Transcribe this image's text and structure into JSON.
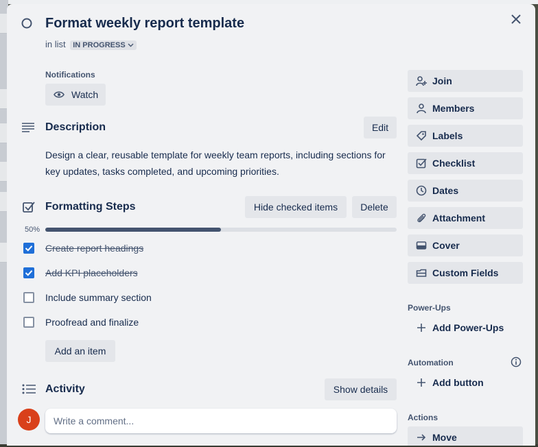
{
  "card": {
    "title": "Format weekly report template",
    "in_list_prefix": "in list",
    "list_name": "IN PROGRESS"
  },
  "notifications": {
    "label": "Notifications",
    "watch_label": "Watch"
  },
  "description": {
    "heading": "Description",
    "edit_label": "Edit",
    "text": "Design a clear, reusable template for weekly team reports, including sections for key updates, tasks completed, and upcoming priorities."
  },
  "checklist": {
    "heading": "Formatting Steps",
    "hide_checked_label": "Hide checked items",
    "delete_label": "Delete",
    "progress_label": "50%",
    "progress": 0.5,
    "items": [
      {
        "text": "Create report headings",
        "checked": true
      },
      {
        "text": "Add KPI placeholders",
        "checked": true
      },
      {
        "text": "Include summary section",
        "checked": false
      },
      {
        "text": "Proofread and finalize",
        "checked": false
      }
    ],
    "add_item_label": "Add an item"
  },
  "activity": {
    "heading": "Activity",
    "show_details_label": "Show details",
    "comment_placeholder": "Write a comment...",
    "avatar_initial": "J"
  },
  "sidebar": {
    "buttons": [
      {
        "label": "Join",
        "icon": "add-person-icon"
      },
      {
        "label": "Members",
        "icon": "person-icon"
      },
      {
        "label": "Labels",
        "icon": "tag-icon"
      },
      {
        "label": "Checklist",
        "icon": "checklist-icon"
      },
      {
        "label": "Dates",
        "icon": "clock-icon"
      },
      {
        "label": "Attachment",
        "icon": "paperclip-icon"
      },
      {
        "label": "Cover",
        "icon": "cover-icon"
      },
      {
        "label": "Custom Fields",
        "icon": "custom-fields-icon"
      }
    ],
    "powerups_label": "Power-Ups",
    "add_powerups_label": "Add Power-Ups",
    "automation_label": "Automation",
    "add_button_label": "Add button",
    "actions_label": "Actions",
    "move_label": "Move"
  },
  "colors": {
    "accent": "#1f6fd8",
    "avatar": "#d9401a",
    "progress_fill": "#44546f"
  }
}
